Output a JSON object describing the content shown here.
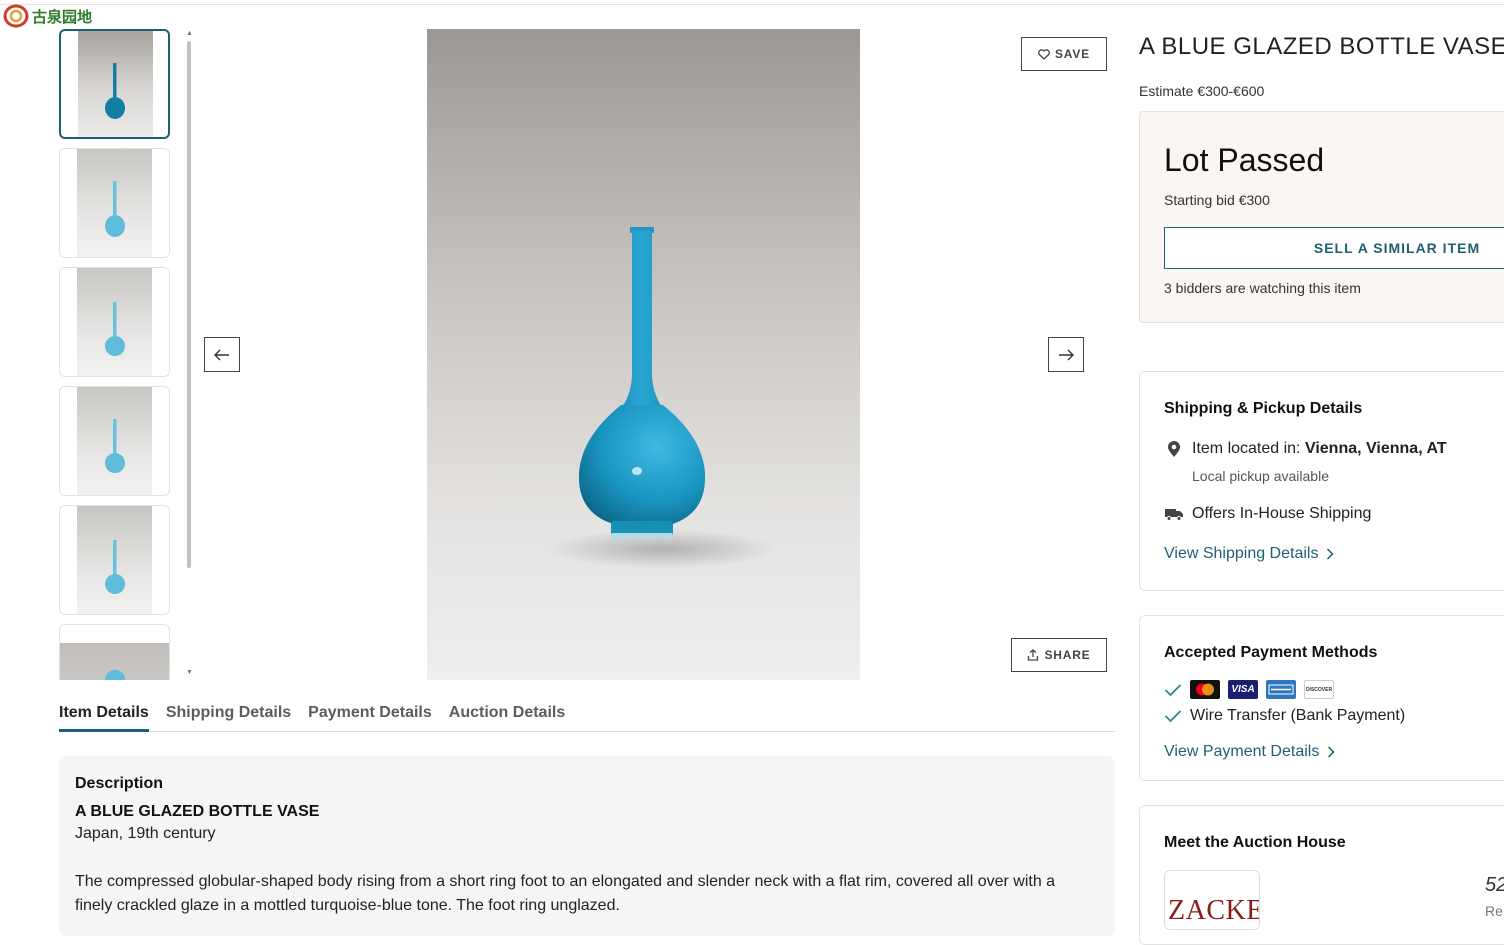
{
  "watermark": {
    "text": "古泉园地"
  },
  "gallery": {
    "thumbnails": [
      "thumb-1",
      "thumb-2",
      "thumb-3",
      "thumb-4",
      "thumb-5",
      "thumb-6"
    ],
    "active_index": 0
  },
  "actions": {
    "save_label": "SAVE",
    "share_label": "SHARE"
  },
  "tabs": [
    "Item Details",
    "Shipping Details",
    "Payment Details",
    "Auction Details"
  ],
  "description": {
    "heading": "Description",
    "title": "A BLUE GLAZED BOTTLE VASE",
    "origin": "Japan, 19th century",
    "body": "The compressed globular-shaped body rising from a short ring foot to an elongated and slender neck with a flat rim, covered all over with a finely crackled glaze in a mottled turquoise-blue tone. The foot ring unglazed."
  },
  "item": {
    "title": "A BLUE GLAZED BOTTLE VASE",
    "estimate": "Estimate €300-€600"
  },
  "status": {
    "label": "Lot Passed",
    "starting_bid": "Starting bid €300",
    "sell_button": "SELL A SIMILAR ITEM",
    "watchers": "3 bidders are watching this item"
  },
  "shipping": {
    "heading": "Shipping & Pickup Details",
    "location_prefix": "Item located in: ",
    "location": "Vienna, Vienna, AT",
    "pickup": "Local pickup available",
    "in_house": "Offers In-House Shipping",
    "link": "View Shipping Details"
  },
  "payment": {
    "heading": "Accepted Payment Methods",
    "cards": [
      "mastercard-icon",
      "visa-icon",
      "amex-icon",
      "discover-icon"
    ],
    "visa_text": "VISA",
    "discover_text": "DISCOVER",
    "wire": "Wire Transfer (Bank Payment)",
    "link": "View Payment Details"
  },
  "auction_house": {
    "heading": "Meet the Auction House",
    "logo_text": "ZACKE",
    "partial_number": "52",
    "partial_label": "Re"
  },
  "colors": {
    "accent": "#1f5f73",
    "vase": "#1a9cc4"
  }
}
